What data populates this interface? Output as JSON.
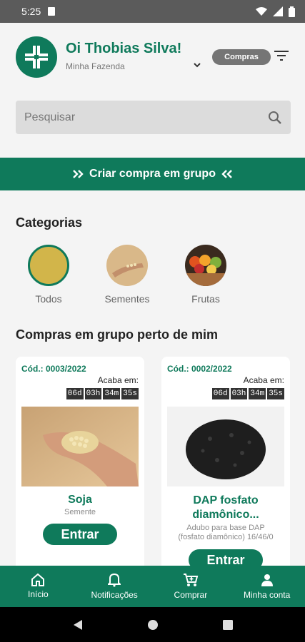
{
  "status_bar": {
    "time": "5:25"
  },
  "header": {
    "greeting": "Oi Thobias Silva!",
    "farm": "Minha Fazenda",
    "pill": "Compras"
  },
  "search": {
    "placeholder": "Pesquisar"
  },
  "banner": {
    "label": "Criar compra em grupo"
  },
  "categories": {
    "title": "Categorias",
    "items": [
      {
        "label": "Todos"
      },
      {
        "label": "Sementes"
      },
      {
        "label": "Frutas"
      }
    ]
  },
  "group_buys": {
    "title": "Compras em grupo perto de mim",
    "cards": [
      {
        "code": "Cód.: 0003/2022",
        "ends_label": "Acaba em:",
        "timer": [
          "06d",
          "03h",
          "34m",
          "35s"
        ],
        "name": "Soja",
        "desc": "Semente",
        "button": "Entrar"
      },
      {
        "code": "Cód.: 0002/2022",
        "ends_label": "Acaba em:",
        "timer": [
          "06d",
          "03h",
          "34m",
          "35s"
        ],
        "name_line1": "DAP fosfato",
        "name_line2": "diamônico...",
        "desc_line1": "Adubo para base DAP",
        "desc_line2": "(fosfato diamônico) 16/46/0",
        "button": "Entrar"
      }
    ]
  },
  "bottom_nav": {
    "items": [
      {
        "label": "Início",
        "icon": "home-icon"
      },
      {
        "label": "Notificações",
        "icon": "bell-icon"
      },
      {
        "label": "Comprar",
        "icon": "cart-icon"
      },
      {
        "label": "Minha conta",
        "icon": "person-icon"
      }
    ]
  },
  "colors": {
    "brand": "#0f7a5b",
    "background": "#f4f4f4"
  }
}
